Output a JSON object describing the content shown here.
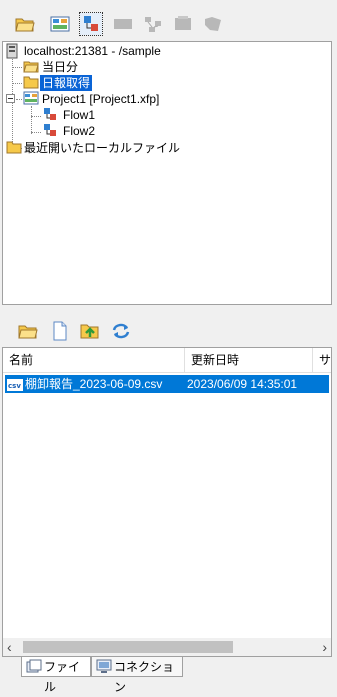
{
  "tree_toolbar": {
    "buttons": [
      "open-folder-icon",
      "layout-icon",
      "flow-icon",
      "disabled-icon-1",
      "disabled-icon-2",
      "disabled-icon-3",
      "disabled-icon-4"
    ]
  },
  "tree": {
    "server": "localhost:21381 - /sample",
    "folders": [
      "当日分",
      "日報取得"
    ],
    "project": "Project1 [Project1.xfp]",
    "flows": [
      "Flow1",
      "Flow2"
    ],
    "recent": "最近開いたローカルファイル"
  },
  "file_toolbar": {
    "buttons": [
      "open-folder-icon",
      "new-file-icon",
      "up-folder-icon",
      "refresh-icon"
    ]
  },
  "file_list": {
    "columns": [
      "名前",
      "更新日時",
      "サ"
    ],
    "rows": [
      {
        "name": "棚卸報告_2023-06-09.csv",
        "modified": "2023/06/09 14:35:01",
        "type_badge": "csv"
      }
    ]
  },
  "scroll": {
    "left_arrow": "‹",
    "right_arrow": "›"
  },
  "tabs": [
    "ファイル",
    "コネクション"
  ],
  "colors": {
    "selection": "#0078d7",
    "folder": "#f6c94a"
  }
}
